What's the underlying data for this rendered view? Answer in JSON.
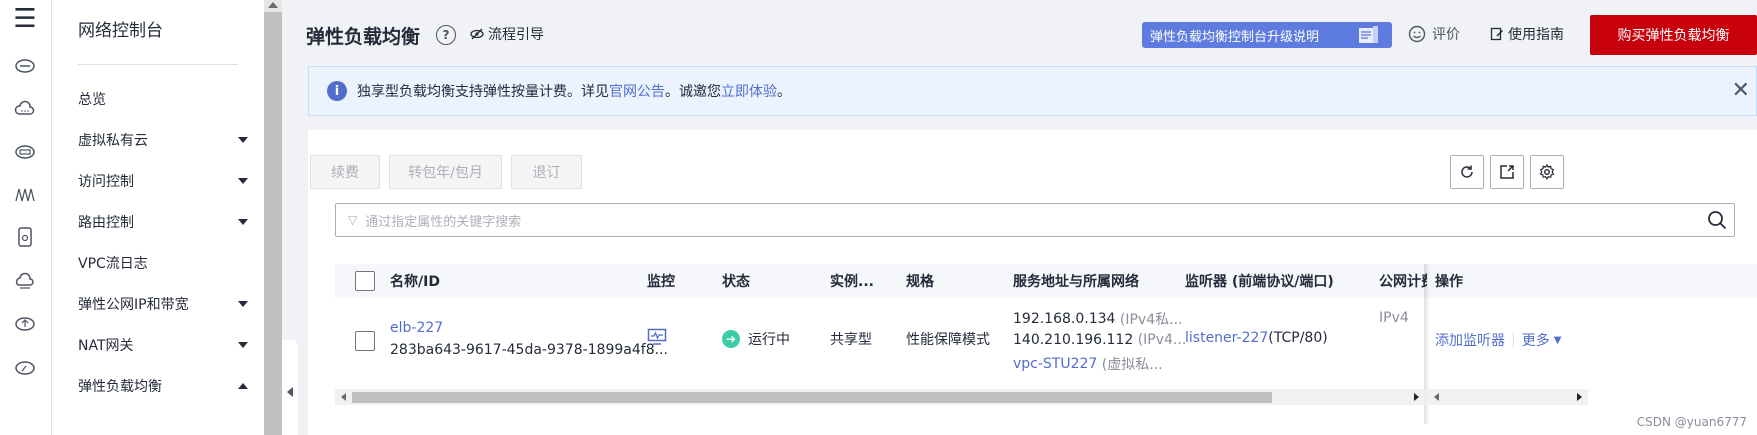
{
  "nav": {
    "title": "网络控制台",
    "items": [
      {
        "label": "总览",
        "expandable": false
      },
      {
        "label": "虚拟私有云",
        "expandable": true
      },
      {
        "label": "访问控制",
        "expandable": true
      },
      {
        "label": "路由控制",
        "expandable": true
      },
      {
        "label": "VPC流日志",
        "expandable": false
      },
      {
        "label": "弹性公网IP和带宽",
        "expandable": true
      },
      {
        "label": "NAT网关",
        "expandable": true
      },
      {
        "label": "弹性负载均衡",
        "expandable": true,
        "expanded": true
      }
    ]
  },
  "header": {
    "title": "弹性负载均衡",
    "guide_label": "流程引导",
    "upgrade_label": "弹性负载均衡控制台升级说明",
    "rate_label": "评价",
    "guide2_label": "使用指南",
    "buy_label": "购买弹性负载均衡"
  },
  "notice": {
    "text_before": "独享型负载均衡支持弹性按量计费。详见",
    "link1": "官网公告",
    "text_middle": "。诚邀您",
    "link2": "立即体验",
    "text_after": "。"
  },
  "toolbar": {
    "renew_label": "续费",
    "convert_label": "转包年/包月",
    "unsubscribe_label": "退订"
  },
  "search": {
    "placeholder": "通过指定属性的关键字搜索"
  },
  "table": {
    "columns": [
      "名称/ID",
      "监控",
      "状态",
      "实例...",
      "规格",
      "服务地址与所属网络",
      "监听器 (前端协议/端口)",
      "公网计费",
      "操作"
    ],
    "rows": [
      {
        "name": "elb-227",
        "id": "283ba643-9617-45da-9378-1899a4f8...",
        "status": "运行中",
        "instance_type": "共享型",
        "spec": "性能保障模式",
        "addr1": "192.168.0.134",
        "addr1_tag": "(IPv4私...",
        "addr2": "140.210.196.112",
        "addr2_tag": "(IPv4...",
        "vpc": "vpc-STU227",
        "vpc_tag": "(虚拟私...",
        "listener": "listener-227",
        "listener_proto": "(TCP/80)",
        "billing": "IPv4",
        "action_add": "添加监听器",
        "action_more": "更多"
      }
    ]
  },
  "watermark": "CSDN @yuan6777",
  "colors": {
    "brand_red": "#c7000b",
    "link_blue": "#526ecc",
    "running_green": "#3dcca6",
    "upgrade_blue": "#5e7ce0"
  }
}
